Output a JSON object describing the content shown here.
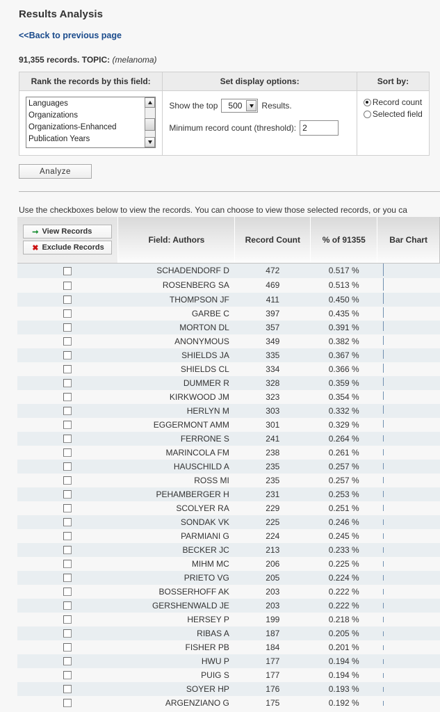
{
  "header": {
    "title": "Results Analysis",
    "back_link": "<<Back to previous page",
    "records_prefix": "91,355 records. TOPIC:",
    "topic": "(melanoma)"
  },
  "options_panel": {
    "rank_header": "Rank the records by this field:",
    "display_header": "Set display options:",
    "sort_header": "Sort by:",
    "field_list": [
      "Languages",
      "Organizations",
      "Organizations-Enhanced",
      "Publication Years"
    ],
    "show_top_label": "Show the top",
    "show_top_value": "500",
    "results_label": "Results.",
    "threshold_label": "Minimum record count (threshold):",
    "threshold_value": "2",
    "sort_options": [
      {
        "label": "Record count",
        "selected": true
      },
      {
        "label": "Selected field",
        "selected": false
      }
    ],
    "analyze_label": "Analyze"
  },
  "results": {
    "instructions": "Use the checkboxes below to view the records. You can choose to view those selected records, or you ca",
    "view_records_label": "View Records",
    "exclude_records_label": "Exclude Records",
    "view_icon": "arrow-right-icon",
    "exclude_icon": "x-mark-icon",
    "columns": {
      "field": "Field: Authors",
      "record_count": "Record Count",
      "pct_prefix": "% of",
      "pct_total": "91355",
      "bar_chart": "Bar Chart"
    },
    "accent_green": "#128a2c",
    "accent_red": "#cc1111",
    "bar_color": "#6f8fb0",
    "rows": [
      {
        "author": "SCHADENDORF D",
        "count": "472",
        "pct": "0.517 %",
        "bar": 18
      },
      {
        "author": "ROSENBERG SA",
        "count": "469",
        "pct": "0.513 %",
        "bar": 18
      },
      {
        "author": "THOMPSON JF",
        "count": "411",
        "pct": "0.450 %",
        "bar": 16
      },
      {
        "author": "GARBE C",
        "count": "397",
        "pct": "0.435 %",
        "bar": 15
      },
      {
        "author": "MORTON DL",
        "count": "357",
        "pct": "0.391 %",
        "bar": 14
      },
      {
        "author": "ANONYMOUS",
        "count": "349",
        "pct": "0.382 %",
        "bar": 13
      },
      {
        "author": "SHIELDS JA",
        "count": "335",
        "pct": "0.367 %",
        "bar": 13
      },
      {
        "author": "SHIELDS CL",
        "count": "334",
        "pct": "0.366 %",
        "bar": 13
      },
      {
        "author": "DUMMER R",
        "count": "328",
        "pct": "0.359 %",
        "bar": 12
      },
      {
        "author": "KIRKWOOD JM",
        "count": "323",
        "pct": "0.354 %",
        "bar": 12
      },
      {
        "author": "HERLYN M",
        "count": "303",
        "pct": "0.332 %",
        "bar": 12
      },
      {
        "author": "EGGERMONT AMM",
        "count": "301",
        "pct": "0.329 %",
        "bar": 11
      },
      {
        "author": "FERRONE S",
        "count": "241",
        "pct": "0.264 %",
        "bar": 9
      },
      {
        "author": "MARINCOLA FM",
        "count": "238",
        "pct": "0.261 %",
        "bar": 9
      },
      {
        "author": "HAUSCHILD A",
        "count": "235",
        "pct": "0.257 %",
        "bar": 9
      },
      {
        "author": "ROSS MI",
        "count": "235",
        "pct": "0.257 %",
        "bar": 9
      },
      {
        "author": "PEHAMBERGER H",
        "count": "231",
        "pct": "0.253 %",
        "bar": 9
      },
      {
        "author": "SCOLYER RA",
        "count": "229",
        "pct": "0.251 %",
        "bar": 9
      },
      {
        "author": "SONDAK VK",
        "count": "225",
        "pct": "0.246 %",
        "bar": 8
      },
      {
        "author": "PARMIANI G",
        "count": "224",
        "pct": "0.245 %",
        "bar": 8
      },
      {
        "author": "BECKER JC",
        "count": "213",
        "pct": "0.233 %",
        "bar": 8
      },
      {
        "author": "MIHM MC",
        "count": "206",
        "pct": "0.225 %",
        "bar": 8
      },
      {
        "author": "PRIETO VG",
        "count": "205",
        "pct": "0.224 %",
        "bar": 8
      },
      {
        "author": "BOSSERHOFF AK",
        "count": "203",
        "pct": "0.222 %",
        "bar": 8
      },
      {
        "author": "GERSHENWALD JE",
        "count": "203",
        "pct": "0.222 %",
        "bar": 8
      },
      {
        "author": "HERSEY P",
        "count": "199",
        "pct": "0.218 %",
        "bar": 8
      },
      {
        "author": "RIBAS A",
        "count": "187",
        "pct": "0.205 %",
        "bar": 7
      },
      {
        "author": "FISHER PB",
        "count": "184",
        "pct": "0.201 %",
        "bar": 7
      },
      {
        "author": "HWU P",
        "count": "177",
        "pct": "0.194 %",
        "bar": 7
      },
      {
        "author": "PUIG S",
        "count": "177",
        "pct": "0.194 %",
        "bar": 7
      },
      {
        "author": "SOYER HP",
        "count": "176",
        "pct": "0.193 %",
        "bar": 7
      },
      {
        "author": "ARGENZIANO G",
        "count": "175",
        "pct": "0.192 %",
        "bar": 7
      }
    ]
  },
  "chart_data": {
    "type": "bar",
    "title": "Field: Authors — Record Count",
    "xlabel": "Record Count",
    "ylabel": "Author",
    "total_records": 91355,
    "categories": [
      "SCHADENDORF D",
      "ROSENBERG SA",
      "THOMPSON JF",
      "GARBE C",
      "MORTON DL",
      "ANONYMOUS",
      "SHIELDS JA",
      "SHIELDS CL",
      "DUMMER R",
      "KIRKWOOD JM",
      "HERLYN M",
      "EGGERMONT AMM",
      "FERRONE S",
      "MARINCOLA FM",
      "HAUSCHILD A",
      "ROSS MI",
      "PEHAMBERGER H",
      "SCOLYER RA",
      "SONDAK VK",
      "PARMIANI G",
      "BECKER JC",
      "MIHM MC",
      "PRIETO VG",
      "BOSSERHOFF AK",
      "GERSHENWALD JE",
      "HERSEY P",
      "RIBAS A",
      "FISHER PB",
      "HWU P",
      "PUIG S",
      "SOYER HP",
      "ARGENZIANO G"
    ],
    "values": [
      472,
      469,
      411,
      397,
      357,
      349,
      335,
      334,
      328,
      323,
      303,
      301,
      241,
      238,
      235,
      235,
      231,
      229,
      225,
      224,
      213,
      206,
      205,
      203,
      203,
      199,
      187,
      184,
      177,
      177,
      176,
      175
    ],
    "percentages": [
      0.517,
      0.513,
      0.45,
      0.435,
      0.391,
      0.382,
      0.367,
      0.366,
      0.359,
      0.354,
      0.332,
      0.329,
      0.264,
      0.261,
      0.257,
      0.257,
      0.253,
      0.251,
      0.246,
      0.245,
      0.233,
      0.225,
      0.224,
      0.222,
      0.222,
      0.218,
      0.205,
      0.201,
      0.194,
      0.194,
      0.193,
      0.192
    ],
    "xlim": [
      0,
      472
    ],
    "grid": false,
    "legend": null
  }
}
